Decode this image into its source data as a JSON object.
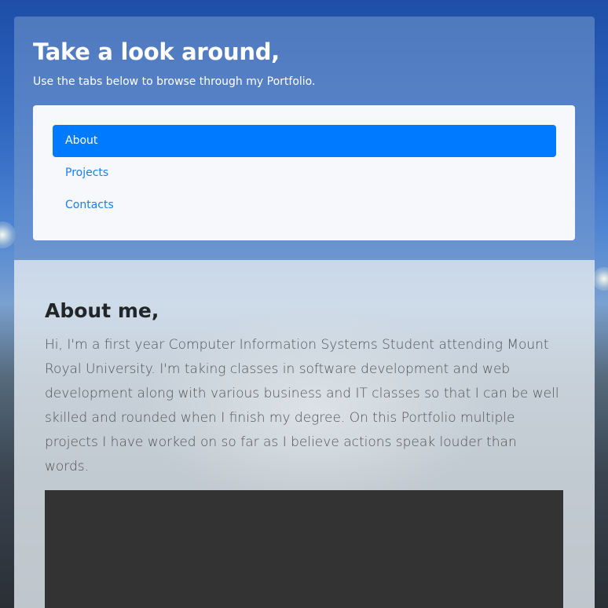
{
  "header": {
    "title": "Take a look around,",
    "subtitle": "Use the tabs below to browse through my Portfolio."
  },
  "tabs": [
    {
      "label": "About",
      "active": true
    },
    {
      "label": "Projects",
      "active": false
    },
    {
      "label": "Contacts",
      "active": false
    }
  ],
  "about": {
    "title": "About me,",
    "body": "Hi, I'm a first year Computer Information Systems Student attending Mount Royal University. I'm taking classes in software development and web development along with various business and IT classes so that I can be well skilled and rounded when I finish my degree. On this Portfolio multiple projects I have worked on so far as I believe actions speak louder than words."
  },
  "colors": {
    "accent": "#007bff",
    "link": "#1a7ef0",
    "media_box": "#333333"
  }
}
